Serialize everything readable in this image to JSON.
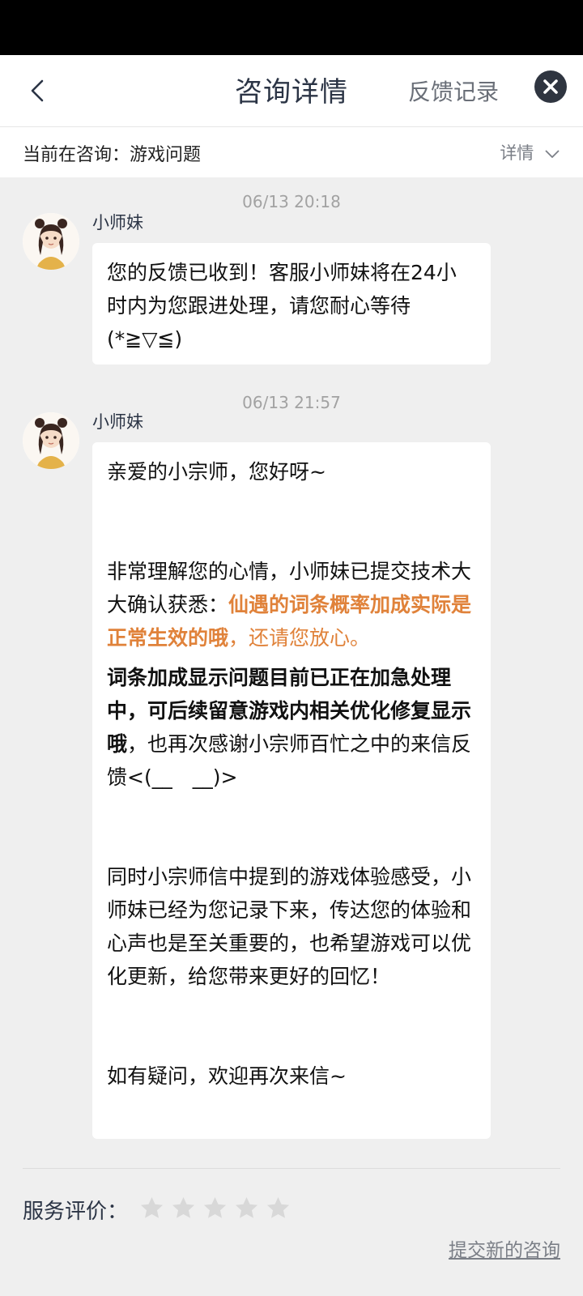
{
  "header": {
    "title": "咨询详情",
    "feedback_label": "反馈记录"
  },
  "consult_bar": {
    "current": "当前在咨询：游戏问题",
    "detail_label": "详情"
  },
  "messages": [
    {
      "time": "06/13 20:18",
      "sender": "小师妹",
      "text": "您的反馈已收到！客服小师妹将在24小时内为您跟进处理，请您耐心等待(*≧▽≦)"
    },
    {
      "time": "06/13 21:57",
      "sender": "小师妹",
      "greeting": "亲爱的小宗师，您好呀~",
      "p1_prefix": "非常理解您的心情，小师妹已提交技术大大确认获悉：",
      "p1_bold": "仙遇的词条概率加成实际是正常生效的哦",
      "p1_suffix": "，还请您放心。",
      "p2_bold": "词条加成显示问题目前已正在加急处理中，可后续留意游戏内相关优化修复显示哦",
      "p2_suffix": "，也再次感谢小宗师百忙之中的来信反馈<(__　__)>",
      "p3": "同时小宗师信中提到的游戏体验感受，小师妹已经为您记录下来，传达您的体验和心声也是至关重要的，也希望游戏可以优化更新，给您带来更好的回忆！",
      "p4": "如有疑问，欢迎再次来信~"
    }
  ],
  "footer": {
    "rating_label": "服务评价：",
    "rating_value": 0,
    "rating_max": 5,
    "new_consult_label": "提交新的咨询"
  },
  "icons": {
    "back": "chevron-left-icon",
    "close": "close-icon",
    "detail": "chevron-down-icon",
    "star": "star-icon"
  },
  "colors": {
    "highlight": "#e0823a",
    "title": "#2b3445",
    "star_empty": "#d8d8d8"
  }
}
